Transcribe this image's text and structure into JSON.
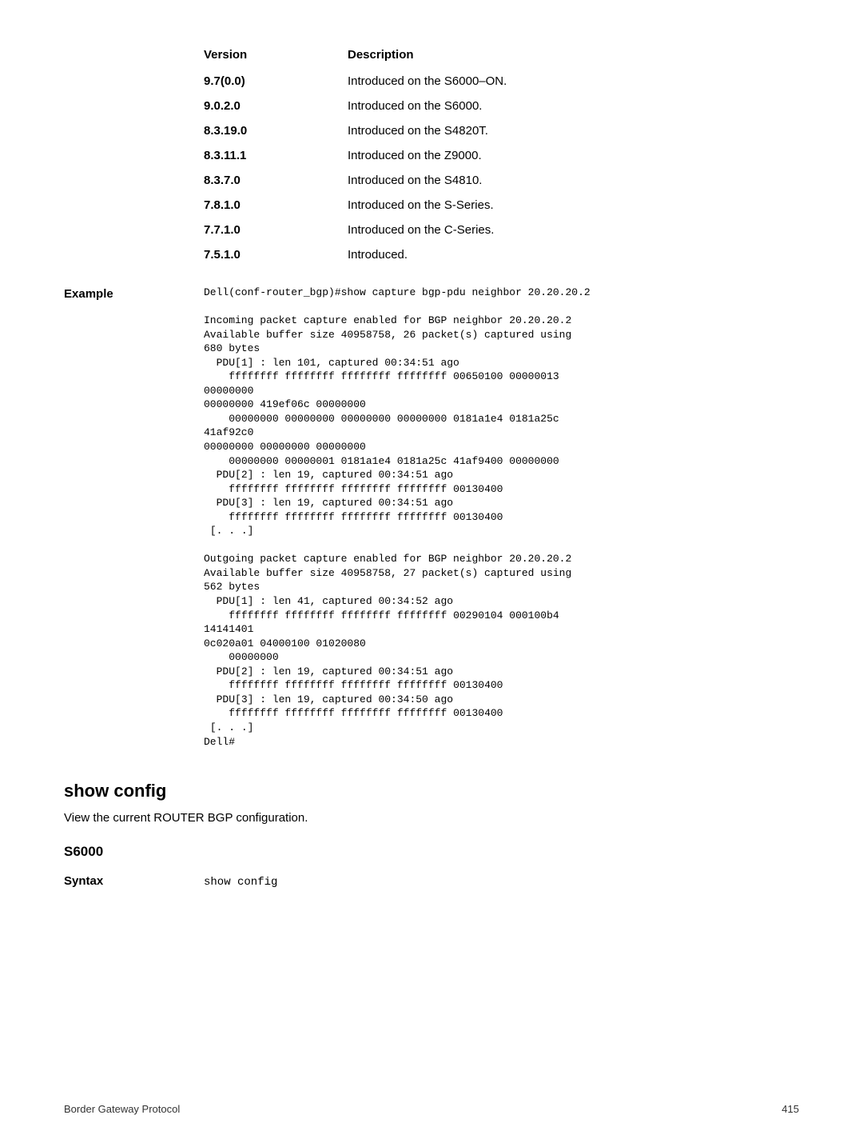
{
  "table": {
    "header_version": "Version",
    "header_desc": "Description",
    "rows": [
      {
        "v": "9.7(0.0)",
        "d": "Introduced on the S6000–ON."
      },
      {
        "v": "9.0.2.0",
        "d": "Introduced on the S6000."
      },
      {
        "v": "8.3.19.0",
        "d": "Introduced on the S4820T."
      },
      {
        "v": "8.3.11.1",
        "d": "Introduced on the Z9000."
      },
      {
        "v": "8.3.7.0",
        "d": "Introduced on the S4810."
      },
      {
        "v": "7.8.1.0",
        "d": "Introduced on the S-Series."
      },
      {
        "v": "7.7.1.0",
        "d": "Introduced on the C-Series."
      },
      {
        "v": "7.5.1.0",
        "d": "Introduced."
      }
    ]
  },
  "example": {
    "label": "Example",
    "body": "Dell(conf-router_bgp)#show capture bgp-pdu neighbor 20.20.20.2\n\nIncoming packet capture enabled for BGP neighbor 20.20.20.2\nAvailable buffer size 40958758, 26 packet(s) captured using\n680 bytes\n  PDU[1] : len 101, captured 00:34:51 ago\n    ffffffff ffffffff ffffffff ffffffff 00650100 00000013\n00000000\n00000000 419ef06c 00000000\n    00000000 00000000 00000000 00000000 0181a1e4 0181a25c\n41af92c0\n00000000 00000000 00000000\n    00000000 00000001 0181a1e4 0181a25c 41af9400 00000000\n  PDU[2] : len 19, captured 00:34:51 ago\n    ffffffff ffffffff ffffffff ffffffff 00130400\n  PDU[3] : len 19, captured 00:34:51 ago\n    ffffffff ffffffff ffffffff ffffffff 00130400\n [. . .]\n\nOutgoing packet capture enabled for BGP neighbor 20.20.20.2\nAvailable buffer size 40958758, 27 packet(s) captured using\n562 bytes\n  PDU[1] : len 41, captured 00:34:52 ago\n    ffffffff ffffffff ffffffff ffffffff 00290104 000100b4\n14141401\n0c020a01 04000100 01020080\n    00000000\n  PDU[2] : len 19, captured 00:34:51 ago\n    ffffffff ffffffff ffffffff ffffffff 00130400\n  PDU[3] : len 19, captured 00:34:50 ago\n    ffffffff ffffffff ffffffff ffffffff 00130400\n [. . .]\nDell#"
  },
  "command": {
    "heading": "show config",
    "desc": "View the current ROUTER BGP configuration.",
    "sub": "S6000",
    "syntax_label": "Syntax",
    "syntax_body": "show config"
  },
  "footer": {
    "left": "Border Gateway Protocol",
    "right": "415"
  }
}
